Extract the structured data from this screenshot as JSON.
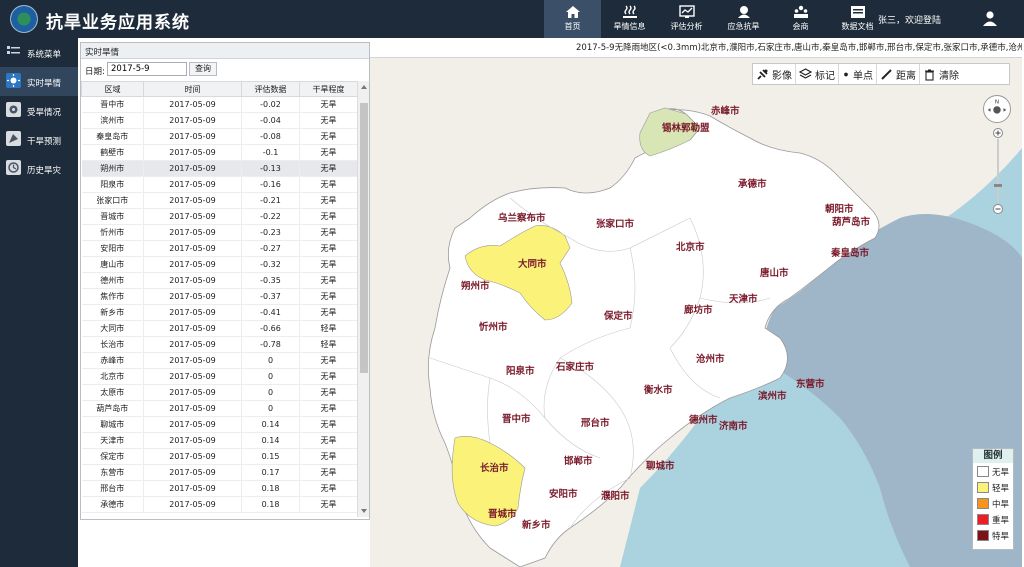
{
  "app": {
    "title": "抗旱业务应用系统",
    "welcome": "张三，欢迎登陆"
  },
  "nav": [
    {
      "label": "首页",
      "icon": "home-icon"
    },
    {
      "label": "旱情信息",
      "icon": "drought-info-icon"
    },
    {
      "label": "评估分析",
      "icon": "evaluation-icon"
    },
    {
      "label": "应急抗旱",
      "icon": "emergency-icon"
    },
    {
      "label": "会商",
      "icon": "consultation-icon"
    },
    {
      "label": "数据文档",
      "icon": "documents-icon"
    }
  ],
  "sidebar": [
    {
      "label": "系统菜单",
      "icon": "menu-icon"
    },
    {
      "label": "实时旱情",
      "icon": "realtime-icon"
    },
    {
      "label": "受旱情况",
      "icon": "affected-icon"
    },
    {
      "label": "干旱预测",
      "icon": "forecast-icon"
    },
    {
      "label": "历史旱灾",
      "icon": "history-icon"
    }
  ],
  "panel": {
    "title": "实时旱情",
    "date_label": "日期:",
    "date_value": "2017-5-9",
    "query_label": "查询",
    "columns": [
      "区域",
      "时间",
      "评估数据",
      "干旱程度"
    ],
    "rows": [
      [
        "晋中市",
        "2017-05-09",
        "-0.02",
        "无旱"
      ],
      [
        "滨州市",
        "2017-05-09",
        "-0.04",
        "无旱"
      ],
      [
        "秦皇岛市",
        "2017-05-09",
        "-0.08",
        "无旱"
      ],
      [
        "鹤壁市",
        "2017-05-09",
        "-0.1",
        "无旱"
      ],
      [
        "朔州市",
        "2017-05-09",
        "-0.13",
        "无旱"
      ],
      [
        "阳泉市",
        "2017-05-09",
        "-0.16",
        "无旱"
      ],
      [
        "张家口市",
        "2017-05-09",
        "-0.21",
        "无旱"
      ],
      [
        "晋城市",
        "2017-05-09",
        "-0.22",
        "无旱"
      ],
      [
        "忻州市",
        "2017-05-09",
        "-0.23",
        "无旱"
      ],
      [
        "安阳市",
        "2017-05-09",
        "-0.27",
        "无旱"
      ],
      [
        "唐山市",
        "2017-05-09",
        "-0.32",
        "无旱"
      ],
      [
        "德州市",
        "2017-05-09",
        "-0.35",
        "无旱"
      ],
      [
        "焦作市",
        "2017-05-09",
        "-0.37",
        "无旱"
      ],
      [
        "新乡市",
        "2017-05-09",
        "-0.41",
        "无旱"
      ],
      [
        "大同市",
        "2017-05-09",
        "-0.66",
        "轻旱"
      ],
      [
        "长治市",
        "2017-05-09",
        "-0.78",
        "轻旱"
      ],
      [
        "赤峰市",
        "2017-05-09",
        "0",
        "无旱"
      ],
      [
        "北京市",
        "2017-05-09",
        "0",
        "无旱"
      ],
      [
        "太原市",
        "2017-05-09",
        "0",
        "无旱"
      ],
      [
        "葫芦岛市",
        "2017-05-09",
        "0",
        "无旱"
      ],
      [
        "聊城市",
        "2017-05-09",
        "0.14",
        "无旱"
      ],
      [
        "天津市",
        "2017-05-09",
        "0.14",
        "无旱"
      ],
      [
        "保定市",
        "2017-05-09",
        "0.15",
        "无旱"
      ],
      [
        "东营市",
        "2017-05-09",
        "0.17",
        "无旱"
      ],
      [
        "邢台市",
        "2017-05-09",
        "0.18",
        "无旱"
      ],
      [
        "承德市",
        "2017-05-09",
        "0.18",
        "无旱"
      ]
    ]
  },
  "marquee": "2017-5-9无降雨地区(<0.3mm)北京市,濮阳市,石家庄市,唐山市,秦皇岛市,邯郸市,邢台市,保定市,张家口市,承德市,沧州市,廊坊市,衡",
  "toolbar": [
    {
      "label": "影像",
      "icon": "satellite-icon"
    },
    {
      "label": "标记",
      "icon": "layers-icon"
    },
    {
      "label": "单点",
      "icon": "point-icon"
    },
    {
      "label": "距离",
      "icon": "ruler-icon"
    },
    {
      "label": "清除",
      "icon": "trash-icon"
    }
  ],
  "map_labels": [
    {
      "name": "赤峰市"
    },
    {
      "name": "锡林郭勒盟"
    },
    {
      "name": "承德市"
    },
    {
      "name": "朝阳市"
    },
    {
      "name": "葫芦岛市"
    },
    {
      "name": "乌兰察布市"
    },
    {
      "name": "张家口市"
    },
    {
      "name": "北京市"
    },
    {
      "name": "秦皇岛市"
    },
    {
      "name": "大同市"
    },
    {
      "name": "唐山市"
    },
    {
      "name": "朔州市"
    },
    {
      "name": "天津市"
    },
    {
      "name": "忻州市"
    },
    {
      "name": "廊坊市"
    },
    {
      "name": "保定市"
    },
    {
      "name": "沧州市"
    },
    {
      "name": "阳泉市"
    },
    {
      "name": "石家庄市"
    },
    {
      "name": "东营市"
    },
    {
      "name": "衡水市"
    },
    {
      "name": "滨州市"
    },
    {
      "name": "晋中市"
    },
    {
      "name": "德州市"
    },
    {
      "name": "济南市"
    },
    {
      "name": "邢台市"
    },
    {
      "name": "长治市"
    },
    {
      "name": "邯郸市"
    },
    {
      "name": "聊城市"
    },
    {
      "name": "安阳市"
    },
    {
      "name": "濮阳市"
    },
    {
      "name": "晋城市"
    },
    {
      "name": "新乡市"
    }
  ],
  "legend": {
    "title": "图例",
    "items": [
      {
        "label": "无旱",
        "color": "#ffffff"
      },
      {
        "label": "轻旱",
        "color": "#fbf27a"
      },
      {
        "label": "中旱",
        "color": "#f7941d"
      },
      {
        "label": "重旱",
        "color": "#ee1c25"
      },
      {
        "label": "特旱",
        "color": "#7b1416"
      }
    ]
  },
  "colors": {
    "header_bg": "#1e2b3a",
    "sea": "#aad3df",
    "land_outside": "#f2efe9",
    "bohai": "#9fb6c8",
    "label": "#7a1a2a"
  }
}
